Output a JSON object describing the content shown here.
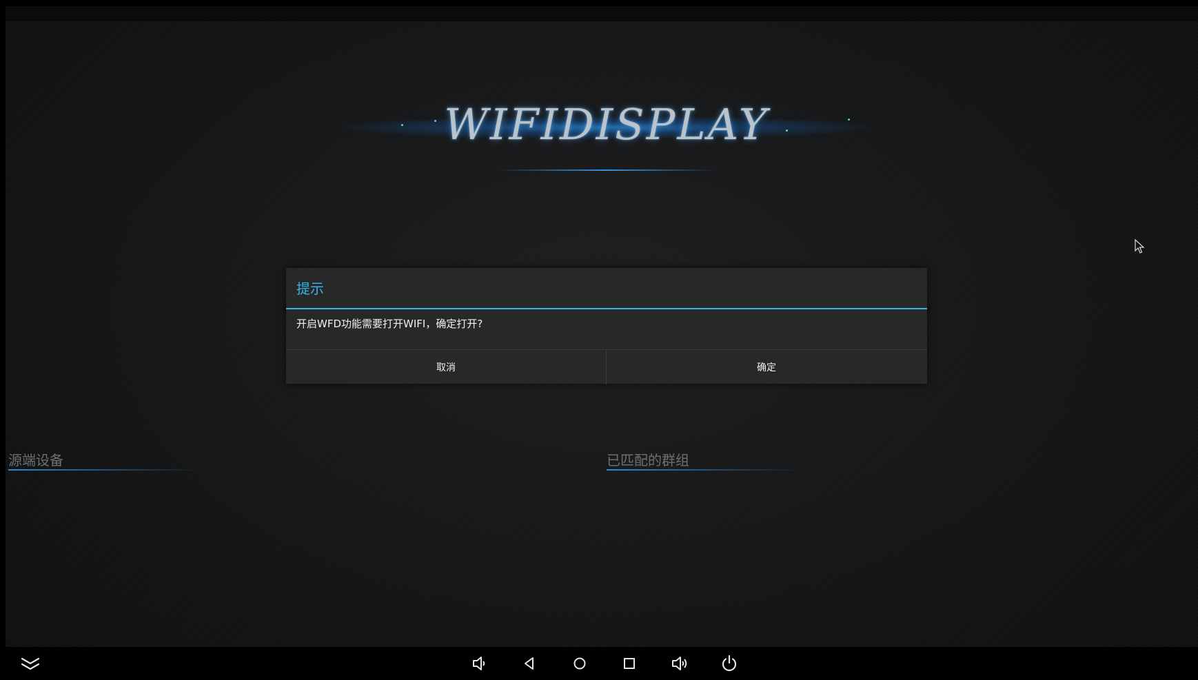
{
  "app": {
    "logo_text": "WIFIDISPLAY"
  },
  "sections": {
    "source_devices": "源端设备",
    "paired_groups": "已匹配的群组"
  },
  "dialog": {
    "title": "提示",
    "message": "开启WFD功能需要打开WIFI，确定打开?",
    "cancel_label": "取消",
    "ok_label": "确定"
  },
  "colors": {
    "accent": "#33b5e5",
    "dialog_bg": "#282828",
    "background": "#151617"
  },
  "navbar": {
    "icons": [
      "hide-bar-icon",
      "volume-down-icon",
      "back-icon",
      "home-icon",
      "recents-icon",
      "volume-up-icon",
      "power-icon"
    ]
  }
}
